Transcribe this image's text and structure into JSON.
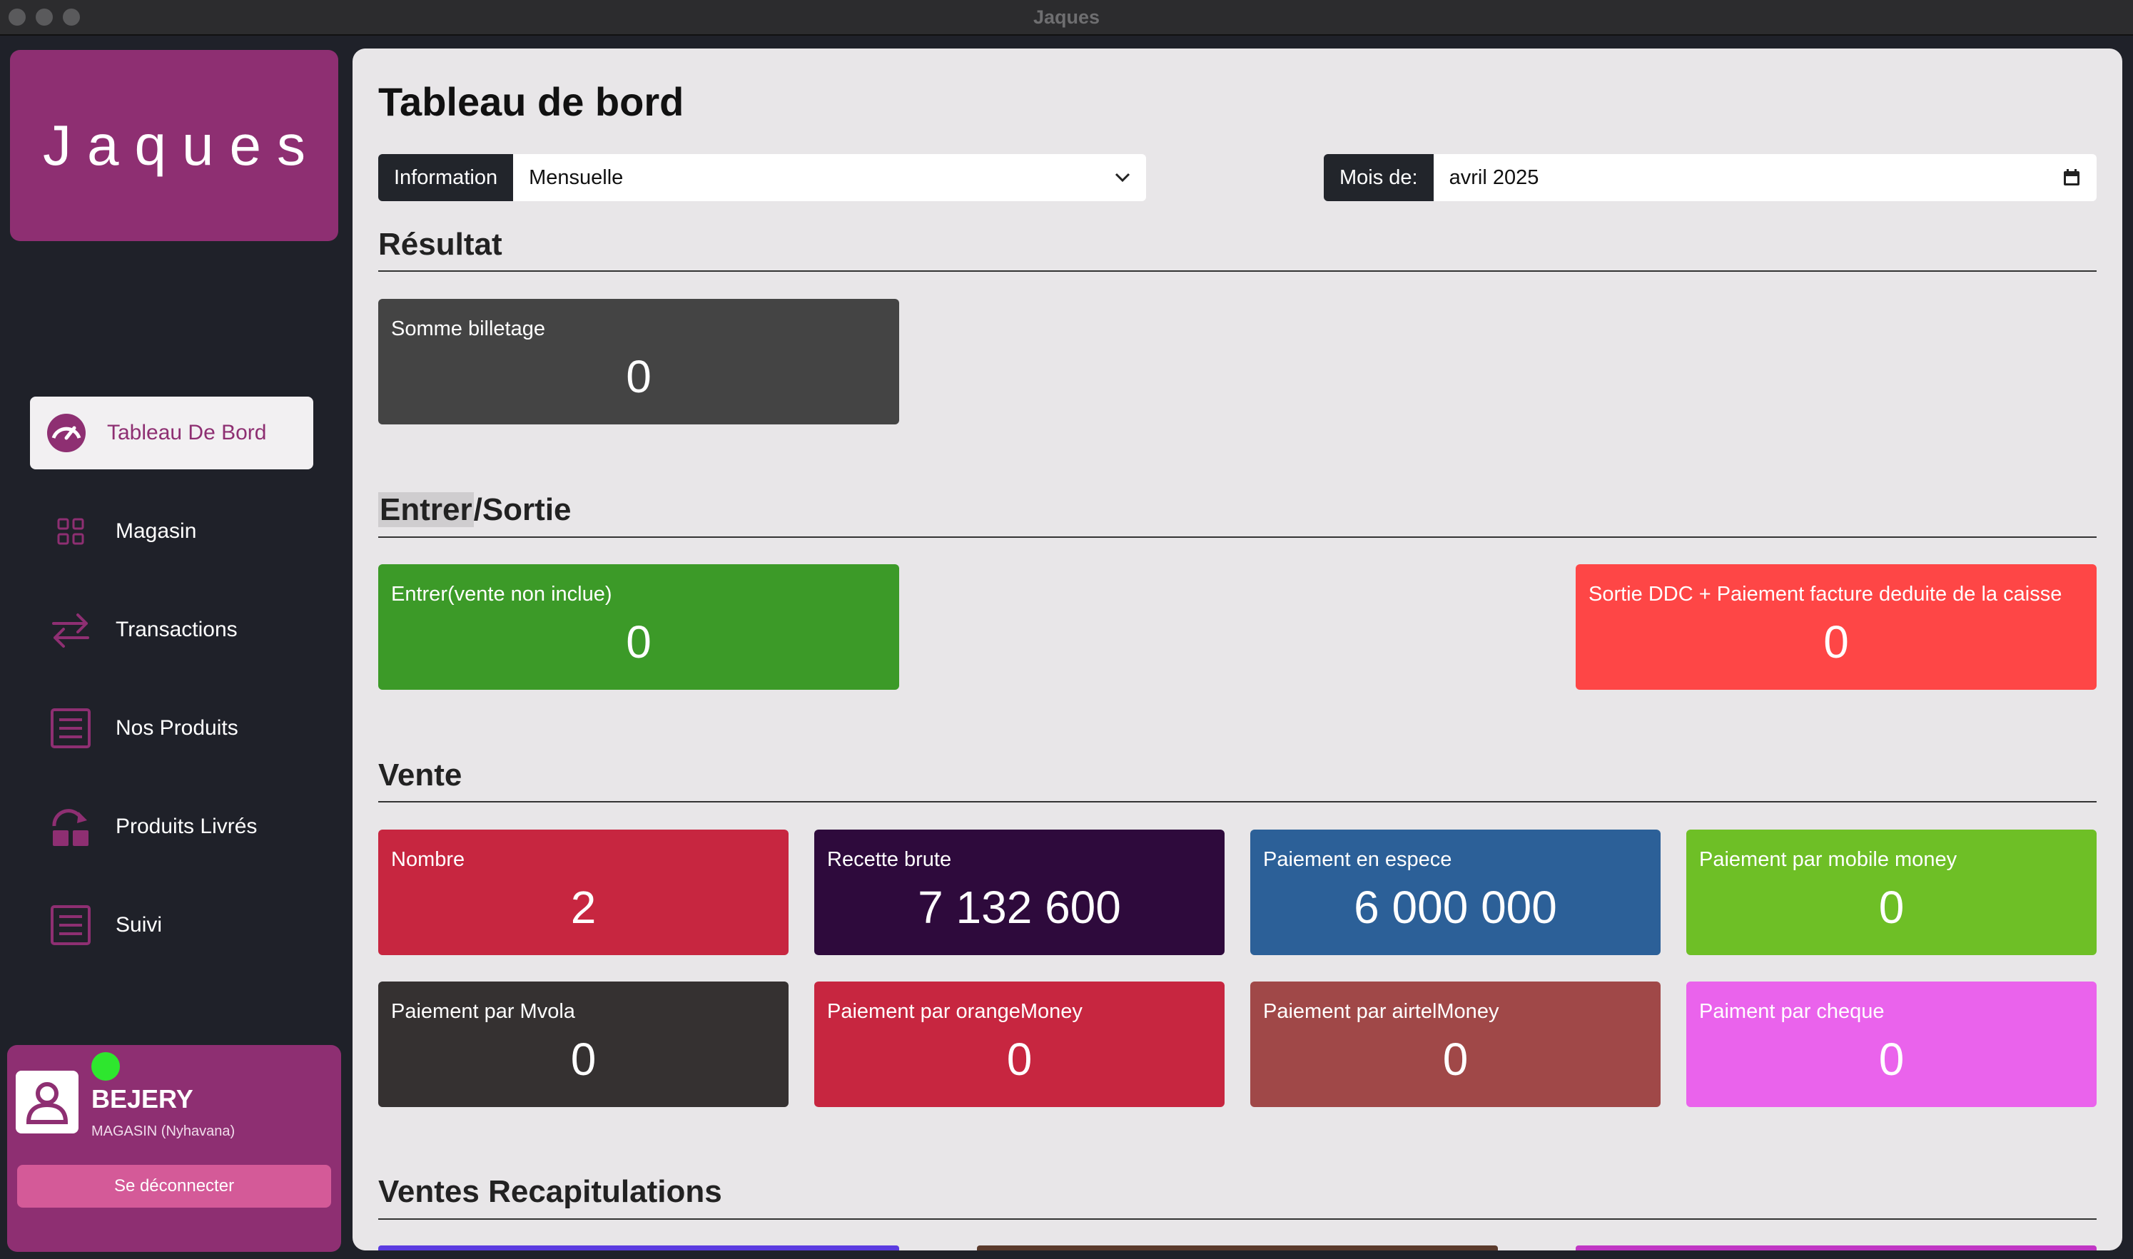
{
  "window": {
    "title": "Jaques"
  },
  "sidebar": {
    "brand": "Jaques",
    "items": [
      {
        "label": "Tableau De Bord",
        "icon": "gauge-icon",
        "active": true
      },
      {
        "label": "Magasin",
        "icon": "grid-icon"
      },
      {
        "label": "Transactions",
        "icon": "arrows-exchange-icon"
      },
      {
        "label": "Nos Produits",
        "icon": "list-icon"
      },
      {
        "label": "Produits Livrés",
        "icon": "delivery-icon"
      },
      {
        "label": "Suivi",
        "icon": "list-icon"
      }
    ],
    "user": {
      "name": "BEJERY",
      "role": "MAGASIN (Nyhavana)",
      "logout_label": "Se déconnecter"
    }
  },
  "main": {
    "title": "Tableau de bord",
    "info_label": "Information",
    "info_value": "Mensuelle",
    "month_label": "Mois de:",
    "month_value": "avril 2025",
    "sections": {
      "resultat": "Résultat",
      "entrer_sortie_a": "Entrer",
      "entrer_sortie_b": "/Sortie",
      "vente": "Vente",
      "recap": "Ventes Recapitulations"
    },
    "resultat_cards": [
      {
        "label": "Somme billetage",
        "value": "0",
        "color": "#444444"
      }
    ],
    "es_cards": [
      {
        "label": "Entrer(vente non inclue)",
        "value": "0",
        "color": "#3c9a28"
      },
      {
        "label": "Sortie DDC + Paiement facture deduite de la caisse",
        "value": "0",
        "color": "#fe4646"
      }
    ],
    "vente_cards": [
      {
        "label": "Nombre",
        "value": "2",
        "color": "#c72640"
      },
      {
        "label": "Recette brute",
        "value": "7 132 600",
        "color": "#2e0a3c"
      },
      {
        "label": "Paiement en espece",
        "value": "6 000 000",
        "color": "#2c6098"
      },
      {
        "label": "Paiement par mobile money",
        "value": "0",
        "color": "#6ebf26"
      },
      {
        "label": "Paiement par Mvola",
        "value": "0",
        "color": "#353131"
      },
      {
        "label": "Paiement par orangeMoney",
        "value": "0",
        "color": "#c72640"
      },
      {
        "label": "Paiement par airtelMoney",
        "value": "0",
        "color": "#a04848"
      },
      {
        "label": "Paiment par cheque",
        "value": "0",
        "color": "#ea63ec"
      }
    ],
    "recap_colors": [
      "#5b3ce0",
      "#5a3a2c",
      "#c036c4"
    ]
  }
}
